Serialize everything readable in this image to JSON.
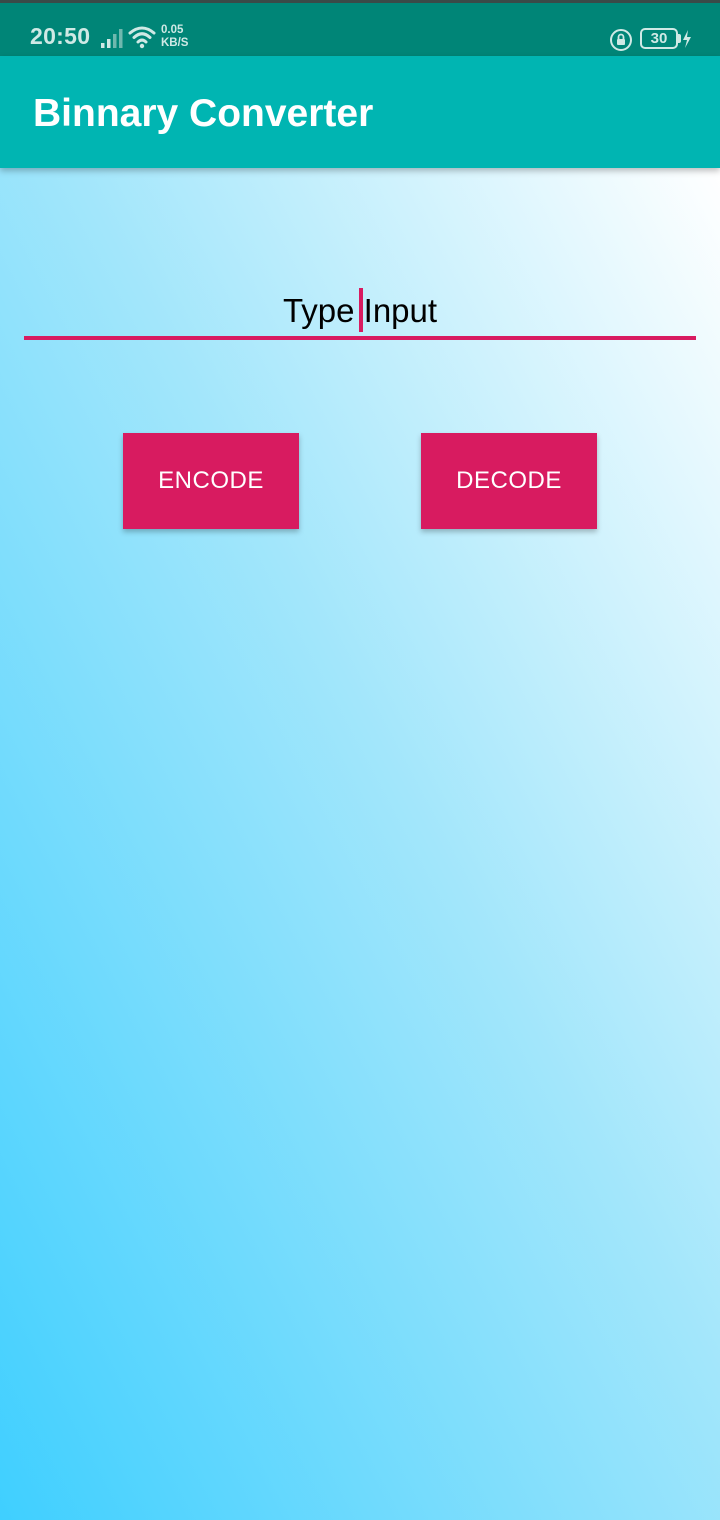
{
  "status_bar": {
    "time": "20:50",
    "speed_value": "0.05",
    "speed_unit": "KB/S",
    "battery_level": "30",
    "icons": [
      "signal-icon",
      "wifi-icon",
      "rotation-lock-icon",
      "battery-icon",
      "charging-icon"
    ]
  },
  "app_bar": {
    "title": "Binnary Converter",
    "color": "#00b5b2"
  },
  "main": {
    "input": {
      "value": "Type Input",
      "accent_color": "#d81b60"
    },
    "buttons": {
      "encode_label": "ENCODE",
      "decode_label": "DECODE",
      "color": "#d81b60"
    }
  }
}
